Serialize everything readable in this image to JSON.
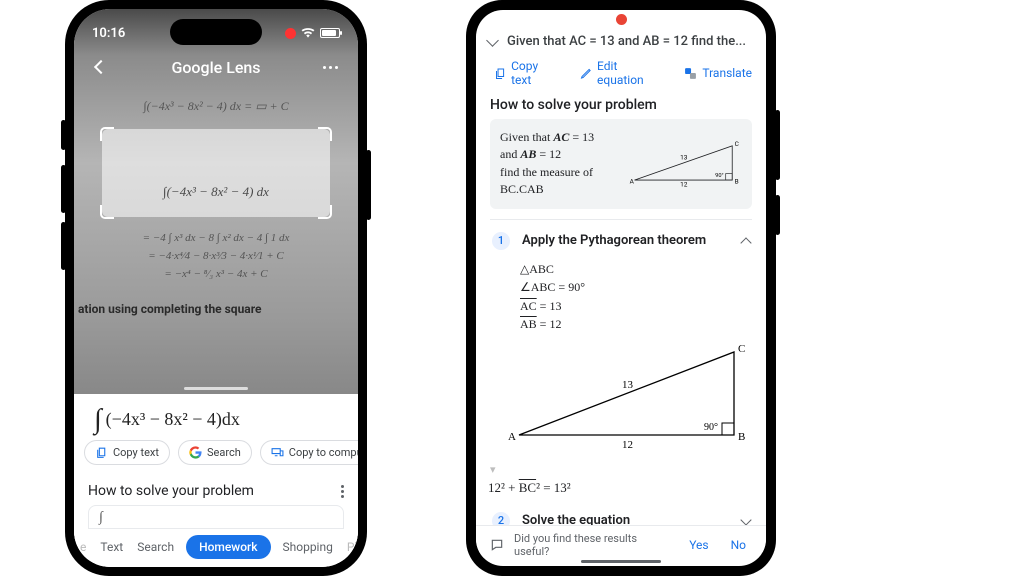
{
  "phone1": {
    "status_time": "10:16",
    "app_title": "Google Lens",
    "bg_equations": {
      "eq0": "∫(−4x³ − 8x² − 4) dx = ▭ + C",
      "eq_crop": "∫(−4x³ − 8x² − 4) dx",
      "eq2": "= −4 ∫ x³ dx − 8 ∫ x² dx − 4 ∫ 1 dx",
      "eq3": "= −4·x⁴⁄4 − 8·x³⁄3 − 4·x¹⁄1 + C",
      "eq4": "= −x⁴ − ⁸⁄₃ x³ − 4x + C",
      "square_text": "ation using completing the square"
    },
    "main_formula": "(−4x³ − 8x² − 4)dx",
    "chips": {
      "copy": "Copy text",
      "search": "Search",
      "copy_pc": "Copy to computer"
    },
    "solve_title": "How to solve your problem",
    "card_stub": "∫",
    "tabs": {
      "t0": "e",
      "t1": "Text",
      "t2": "Search",
      "t3": "Homework",
      "t4": "Shopping",
      "t5": "Places"
    }
  },
  "phone2": {
    "question_short": "Given that AC = 13 and AB = 12 find the...",
    "actions": {
      "copy": "Copy text",
      "edit": "Edit equation",
      "translate": "Translate"
    },
    "h2": "How to solve your problem",
    "problem": {
      "l1a": "Given that ",
      "ac": "AC",
      "eq13": " = 13",
      "l2a": "and ",
      "ab": "AB",
      "eq12": " = 12",
      "l3": "find the measure of",
      "l4": "BC.CAB"
    },
    "tri_small": {
      "A": "A",
      "B": "B",
      "C": "C",
      "lab13": "13",
      "lab12": "12",
      "ang": "90°"
    },
    "step1": {
      "num": "1",
      "title": "Apply the Pythagorean theorem",
      "facts": {
        "f1": "△ABC",
        "f2": "∠ABC = 90°",
        "f3a": "AC",
        "f3b": " = 13",
        "f4a": "AB",
        "f4b": " = 12"
      }
    },
    "tri_big": {
      "A": "A",
      "B": "B",
      "C": "C",
      "lab13": "13",
      "lab12": "12",
      "ang": "90°"
    },
    "pyth": {
      "a": "12² + ",
      "bc": "BC",
      "b": "² = 13²"
    },
    "step2": {
      "num": "2",
      "title": "Solve the equation"
    },
    "footer": {
      "q": "Did you find these results useful?",
      "yes": "Yes",
      "no": "No"
    }
  }
}
